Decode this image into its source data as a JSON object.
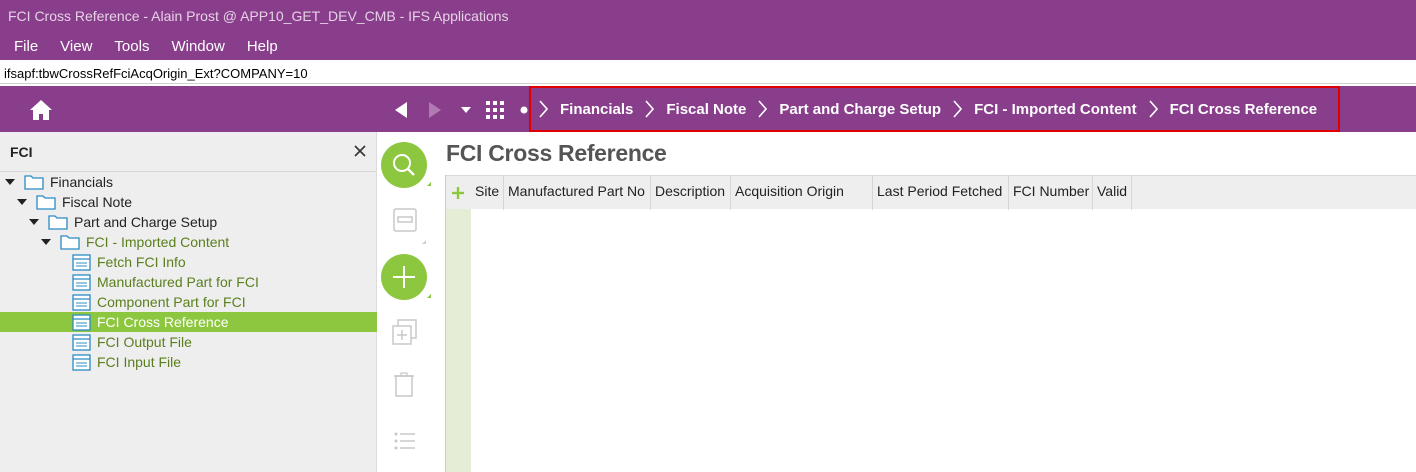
{
  "window": {
    "title": "FCI Cross Reference - Alain Prost @ APP10_GET_DEV_CMB - IFS Applications"
  },
  "menu": [
    "File",
    "View",
    "Tools",
    "Window",
    "Help"
  ],
  "address": {
    "value": "ifsapf:tbwCrossRefFciAcqOrigin_Ext?COMPANY=10"
  },
  "breadcrumb": [
    "Financials",
    "Fiscal Note",
    "Part and Charge Setup",
    "FCI - Imported Content",
    "FCI Cross Reference"
  ],
  "sidebar": {
    "title": "FCI",
    "tree": [
      {
        "label": "Financials",
        "type": "folder",
        "expanded": true
      },
      {
        "label": "Fiscal Note",
        "type": "folder",
        "expanded": true
      },
      {
        "label": "Part and Charge Setup",
        "type": "folder",
        "expanded": true
      },
      {
        "label": "FCI - Imported Content",
        "type": "folder",
        "expanded": true
      },
      {
        "label": "Fetch FCI Info",
        "type": "page"
      },
      {
        "label": "Manufactured Part for FCI",
        "type": "page"
      },
      {
        "label": "Component Part for FCI",
        "type": "page"
      },
      {
        "label": "FCI Cross Reference",
        "type": "page",
        "selected": true
      },
      {
        "label": "FCI Output File",
        "type": "page"
      },
      {
        "label": "FCI Input File",
        "type": "page"
      }
    ]
  },
  "main": {
    "title": "FCI Cross Reference",
    "columns": [
      "Site",
      "Manufactured Part No",
      "Description",
      "Acquisition Origin",
      "Last Period Fetched",
      "FCI Number",
      "Valid"
    ]
  },
  "colors": {
    "brand_purple": "#893e8c",
    "accent_green": "#8dc63f",
    "breadcrumb_highlight": "#e00000",
    "tree_link": "#5a7f1c"
  },
  "icons": [
    "home-icon",
    "back-arrow-icon",
    "forward-arrow-icon",
    "dropdown-icon",
    "apps-grid-icon",
    "search-icon",
    "save-icon",
    "add-icon",
    "duplicate-icon",
    "delete-icon",
    "list-icon",
    "close-icon",
    "folder-icon",
    "page-icon"
  ]
}
